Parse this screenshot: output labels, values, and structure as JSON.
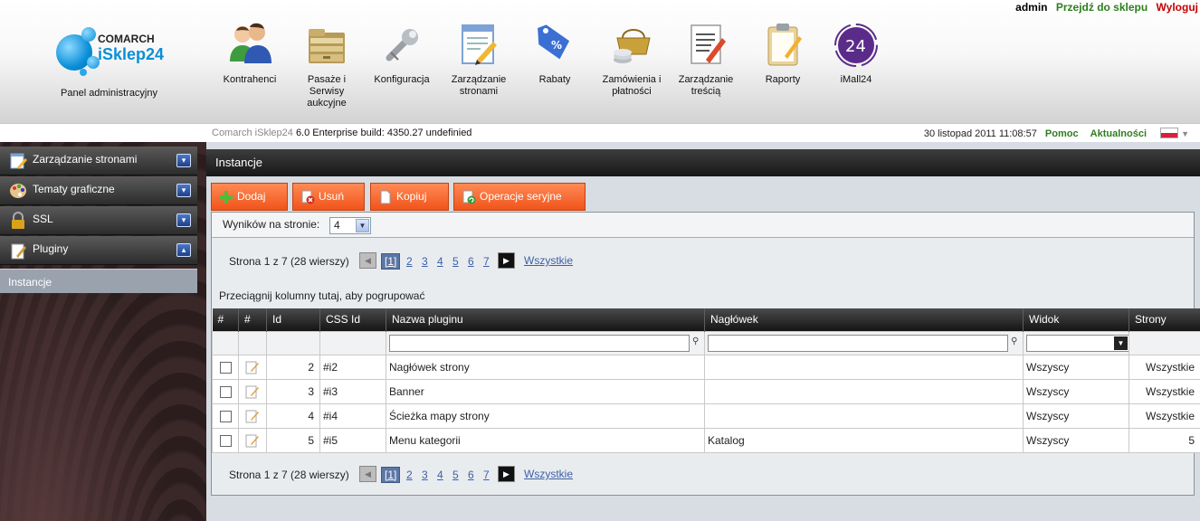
{
  "user": {
    "name": "admin",
    "shop_link": "Przejdź do sklepu",
    "logout": "Wyloguj"
  },
  "logo": {
    "brand_top": "COMARCH",
    "brand_main": "iSklep24"
  },
  "panel_label": "Panel administracyjny",
  "nav": [
    {
      "label": "Kontrahenci",
      "icon": "users-icon"
    },
    {
      "label": "Pasaże i Serwisy aukcyjne",
      "icon": "folders-icon"
    },
    {
      "label": "Konfiguracja",
      "icon": "wrench-icon"
    },
    {
      "label": "Zarządzanie stronami",
      "icon": "page-edit-icon"
    },
    {
      "label": "Rabaty",
      "icon": "price-tag-icon"
    },
    {
      "label": "Zamówienia i płatności",
      "icon": "basket-coins-icon"
    },
    {
      "label": "Zarządzanie treścią",
      "icon": "document-pencil-icon"
    },
    {
      "label": "Raporty",
      "icon": "clipboard-icon"
    },
    {
      "label": "iMall24",
      "icon": "imall24-icon"
    }
  ],
  "status": {
    "build_prefix": "Comarch iSklep24",
    "build": "6.0 Enterprise build: 4350.27",
    "build_suffix": "undefinied",
    "datetime": "30 listopad 2011 11:08:57",
    "help": "Pomoc",
    "news": "Aktualności",
    "language_icon": "poland-flag-icon"
  },
  "sidebar": {
    "sections": [
      {
        "label": "Zarządzanie stronami",
        "icon": "page-edit-icon",
        "toggle": "▾"
      },
      {
        "label": "Tematy graficzne",
        "icon": "palette-icon",
        "toggle": "▾"
      },
      {
        "label": "SSL",
        "icon": "lock-icon",
        "toggle": "▾"
      },
      {
        "label": "Pluginy",
        "icon": "plugin-icon",
        "toggle": "▴"
      }
    ],
    "active_item": "Instancje"
  },
  "content": {
    "title": "Instancje",
    "toolbar": {
      "add": "Dodaj",
      "delete": "Usuń",
      "copy": "Kopiuj",
      "batch": "Operacje seryjne"
    },
    "per_page_label": "Wyników na stronie:",
    "per_page_value": "4",
    "pager": {
      "info": "Strona 1 z 7 (28 wierszy)",
      "current": "[1]",
      "pages": [
        "2",
        "3",
        "4",
        "5",
        "6",
        "7"
      ],
      "all": "Wszystkie"
    },
    "group_hint": "Przeciągnij kolumny tutaj, aby pogrupować",
    "columns": [
      "#",
      "#",
      "Id",
      "CSS Id",
      "Nazwa pluginu",
      "Nagłówek",
      "Widok",
      "Strony"
    ],
    "rows": [
      {
        "id": "2",
        "css": "#i2",
        "name": "Nagłówek strony",
        "header": "",
        "view": "Wszyscy",
        "pages": "Wszystkie"
      },
      {
        "id": "3",
        "css": "#i3",
        "name": "Banner",
        "header": "",
        "view": "Wszyscy",
        "pages": "Wszystkie"
      },
      {
        "id": "4",
        "css": "#i4",
        "name": "Ścieżka mapy strony",
        "header": "",
        "view": "Wszyscy",
        "pages": "Wszystkie"
      },
      {
        "id": "5",
        "css": "#i5",
        "name": "Menu kategorii",
        "header": "Katalog",
        "view": "Wszyscy",
        "pages": "5"
      }
    ]
  }
}
